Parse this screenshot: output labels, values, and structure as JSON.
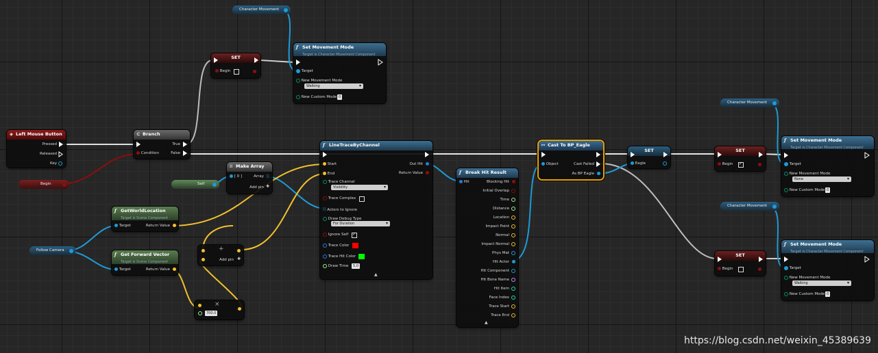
{
  "colors": {
    "exec": "#ffffff",
    "object": "#1e9bd7",
    "vector": "#f2c12e",
    "bool": "#8c0e0e",
    "struct_ptr": "#2a7bd7",
    "float": "#9cf28a",
    "linear_color": "#2e77f0",
    "string": "#f03ad8",
    "name": "#c08cf2",
    "int": "#17e0b0",
    "byte": "#006e5a"
  },
  "nodes": {
    "char_move_top": {
      "label": "Character Movement"
    },
    "set_top": {
      "title": "SET",
      "begin": "Begin"
    },
    "set_mode_top": {
      "title": "Set Movement Mode",
      "subtitle": "Target is Character Movement Component",
      "target": "Target",
      "new_mode": "New Movement Mode",
      "mode_value": "Walking",
      "custom": "New Custom Mode",
      "custom_value": "0"
    },
    "lmb": {
      "title": "Left Mouse Button",
      "pressed": "Pressed",
      "released": "Released",
      "key": "Key"
    },
    "begin_var": {
      "label": "Begin"
    },
    "branch": {
      "title": "Branch",
      "condition": "Condition",
      "true_label": "True",
      "false_label": "False"
    },
    "self_var": {
      "label": "Self"
    },
    "make_array": {
      "title": "Make Array",
      "item0": "[ 0 ]",
      "array": "Array",
      "addpin": "Add pin"
    },
    "get_world_loc": {
      "title": "GetWorldLocation",
      "subtitle": "Target is Scene Component",
      "target": "Target",
      "ret": "Return Value"
    },
    "follow_cam": {
      "label": "Follow Camera"
    },
    "get_fwd": {
      "title": "Get Forward Vector",
      "subtitle": "Target is Scene Component",
      "target": "Target",
      "ret": "Return Value"
    },
    "add_node": {
      "symbol": "+",
      "addpin": "Add pin"
    },
    "mul_node": {
      "symbol": "×",
      "value": "700.0"
    },
    "line_trace": {
      "title": "LineTraceByChannel",
      "start": "Start",
      "end": "End",
      "trace_channel": "Trace Channel",
      "channel_value": "Visibility",
      "trace_complex": "Trace Complex",
      "actors_ignore": "Actors to Ignore",
      "draw_debug": "Draw Debug Type",
      "debug_value": "For Duration",
      "ignore_self": "Ignore Self",
      "trace_color": "Trace Color",
      "hit_color": "Trace Hit Color",
      "draw_time": "Draw Time",
      "draw_time_value": "5.0",
      "out_hit": "Out Hit",
      "ret": "Return Value"
    },
    "break_hit": {
      "title": "Break Hit Result",
      "hit": "Hit",
      "outputs": [
        "Blocking Hit",
        "Initial Overlap",
        "Time",
        "Distance",
        "Location",
        "Impact Point",
        "Normal",
        "Impact Normal",
        "Phys Mat",
        "Hit Actor",
        "Hit Component",
        "Hit Bone Name",
        "Hit Item",
        "Face Index",
        "Trace Start",
        "Trace End"
      ]
    },
    "cast": {
      "title": "Cast To BP_Eagle",
      "object": "Object",
      "failed": "Cast Failed",
      "as": "As BP Eagle"
    },
    "set_eagle": {
      "title": "SET",
      "eagle": "Eagle"
    },
    "set_mid": {
      "title": "SET",
      "begin": "Begin"
    },
    "char_move_r1": {
      "label": "Character Movement"
    },
    "set_mode_r1": {
      "title": "Set Movement Mode",
      "subtitle": "Target is Character Movement Component",
      "target": "Target",
      "new_mode": "New Movement Mode",
      "mode_value": "None",
      "custom": "New Custom Mode",
      "custom_value": "0"
    },
    "char_move_r2": {
      "label": "Character Movement"
    },
    "set_low": {
      "title": "SET",
      "begin": "Begin"
    },
    "set_mode_r2": {
      "title": "Set Movement Mode",
      "subtitle": "Target is Character Movement Component",
      "target": "Target",
      "new_mode": "New Movement Mode",
      "mode_value": "Walking",
      "custom": "New Custom Mode",
      "custom_value": "0"
    }
  },
  "watermark": "https://blog.csdn.net/weixin_45389639"
}
